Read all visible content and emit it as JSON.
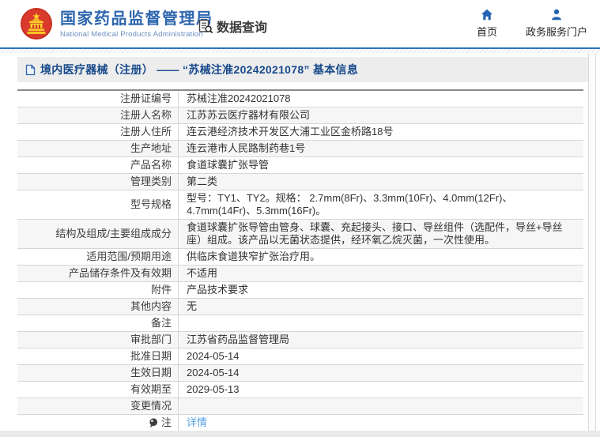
{
  "colors": {
    "accent_blue": "#2d66ae",
    "divider_blue": "#2e74b5",
    "link_blue": "#54a0e4",
    "emblem_red": "#d93a2b",
    "emblem_gold": "#ffd42a"
  },
  "header": {
    "site_title": "国家药品监督管理局",
    "site_subtitle": "National Medical Products Administration",
    "data_query_label": "数据查询",
    "nav_home": "首页",
    "nav_portal": "政务服务门户"
  },
  "breadcrumb": {
    "text": "境内医疗器械（注册） —— “苏械注准20242021078” 基本信息"
  },
  "table": {
    "rows": [
      {
        "label": "注册证编号",
        "value": "苏械注准20242021078"
      },
      {
        "label": "注册人名称",
        "value": "江苏苏云医疗器材有限公司"
      },
      {
        "label": "注册人住所",
        "value": "连云港经济技术开发区大浦工业区金桥路18号"
      },
      {
        "label": "生产地址",
        "value": "连云港市人民路制药巷1号"
      },
      {
        "label": "产品名称",
        "value": "食道球囊扩张导管"
      },
      {
        "label": "管理类别",
        "value": "第二类"
      },
      {
        "label": "型号规格",
        "value": "型号：TY1、TY2。规格： 2.7mm(8Fr)、3.3mm(10Fr)、4.0mm(12Fr)、4.7mm(14Fr)、5.3mm(16Fr)。"
      },
      {
        "label": "结构及组成/主要组成成分",
        "value": "食道球囊扩张导管由管身、球囊、充起接头、接口、导丝组件（选配件，导丝+导丝座）组成。该产品以无菌状态提供，经环氧乙烷灭菌，一次性使用。"
      },
      {
        "label": "适用范围/预期用途",
        "value": "供临床食道狭窄扩张治疗用。"
      },
      {
        "label": "产品储存条件及有效期",
        "value": "不适用"
      },
      {
        "label": "附件",
        "value": "产品技术要求"
      },
      {
        "label": "其他内容",
        "value": "无"
      },
      {
        "label": "备注",
        "value": ""
      },
      {
        "label": "审批部门",
        "value": "江苏省药品监督管理局"
      },
      {
        "label": "批准日期",
        "value": "2024-05-14"
      },
      {
        "label": "生效日期",
        "value": "2024-05-14"
      },
      {
        "label": "有效期至",
        "value": "2029-05-13"
      },
      {
        "label": "变更情况",
        "value": ""
      },
      {
        "label": "注",
        "value": "详情",
        "icon": "note-icon",
        "link": true
      }
    ]
  }
}
